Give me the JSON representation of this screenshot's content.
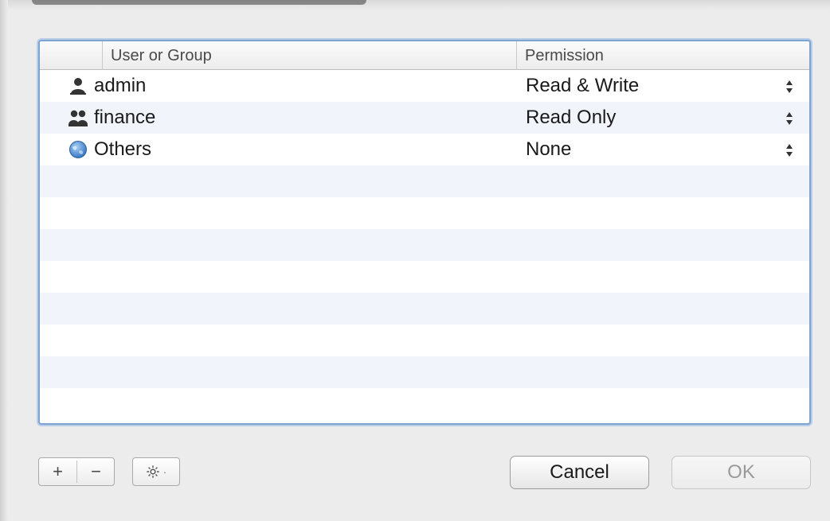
{
  "table": {
    "columns": [
      {
        "label": "User or Group"
      },
      {
        "label": "Permission"
      }
    ],
    "rows": [
      {
        "icon": "single-user-icon",
        "name": "admin",
        "permission": "Read & Write"
      },
      {
        "icon": "group-icon",
        "name": "finance",
        "permission": "Read Only"
      },
      {
        "icon": "globe-icon",
        "name": "Others",
        "permission": "None"
      }
    ]
  },
  "toolbar": {
    "add_label": "+",
    "remove_label": "−",
    "gear_icon": "gear-icon",
    "gear_chevron": "·"
  },
  "buttons": {
    "cancel_label": "Cancel",
    "ok_label": "OK"
  },
  "colors": {
    "focus_ring": "#7ea3cf",
    "row_stripe": "#f1f5fb",
    "globe_blue": "#3d86d6"
  }
}
